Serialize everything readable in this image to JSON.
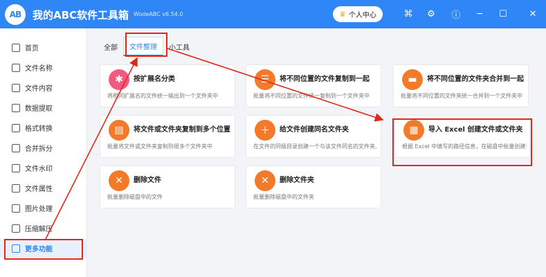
{
  "app": {
    "logo_text": "AB",
    "title": "我的ABC软件工具箱",
    "version": "WodeABC v6.54.0",
    "user_center": "个人中心"
  },
  "sidebar": {
    "items": [
      {
        "label": "首页",
        "icon": "home-icon"
      },
      {
        "label": "文件名称",
        "icon": "file-name-icon"
      },
      {
        "label": "文件内容",
        "icon": "file-content-icon"
      },
      {
        "label": "数据提取",
        "icon": "data-extract-icon"
      },
      {
        "label": "格式转换",
        "icon": "format-convert-icon"
      },
      {
        "label": "合并拆分",
        "icon": "merge-split-icon"
      },
      {
        "label": "文件水印",
        "icon": "watermark-icon"
      },
      {
        "label": "文件属性",
        "icon": "file-attr-icon"
      },
      {
        "label": "图片处理",
        "icon": "image-icon"
      },
      {
        "label": "压缩解压",
        "icon": "compress-icon"
      },
      {
        "label": "更多功能",
        "icon": "more-icon"
      }
    ]
  },
  "tabs": [
    "全部",
    "文件整理",
    "小工具"
  ],
  "cards": [
    {
      "title": "按扩展名分类",
      "desc": "将相同扩展名的文件统一输出到一个文件夹中"
    },
    {
      "title": "将不同位置的文件复制到一起",
      "desc": "批量将不同位置的文件统一复制到一个文件夹中"
    },
    {
      "title": "将不同位置的文件夹合并到一起",
      "desc": "批量将不同位置的文件夹统一合并到一个文件夹中"
    },
    {
      "title": "将文件或文件夹复制到多个位置",
      "desc": "批量将文件或文件夹复制到很多个文件夹中"
    },
    {
      "title": "给文件创建同名文件夹",
      "desc": "在文件的同级目录创建一个与该文件同名的文件夹,"
    },
    {
      "title": "导入 Excel 创建文件或文件夹",
      "desc": "根据 Excel 中填写的路径信息，在磁盘中批量创建该"
    },
    {
      "title": "删除文件",
      "desc": "批量删除磁盘中的文件"
    },
    {
      "title": "删除文件夹",
      "desc": "批量删除磁盘中的文件夹"
    }
  ],
  "colors": {
    "brand": "#2f86f6",
    "highlight": "#e0271b"
  }
}
